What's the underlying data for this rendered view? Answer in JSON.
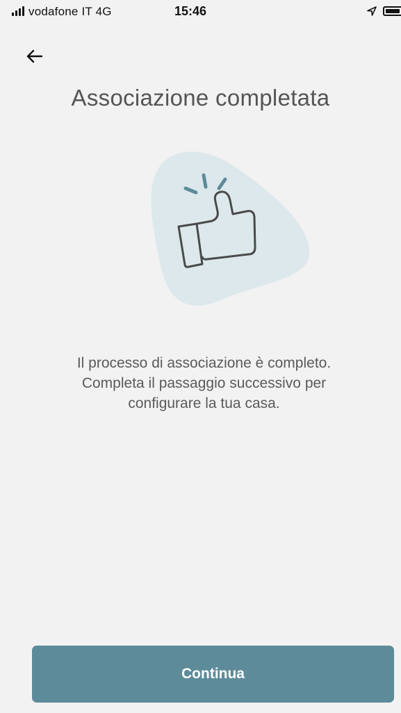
{
  "status_bar": {
    "carrier": "vodafone IT  4G",
    "time": "15:46",
    "icons": [
      "signal-icon",
      "location-icon",
      "battery-icon"
    ]
  },
  "nav": {
    "back_icon": "arrow-left-icon"
  },
  "title": "Associazione completata",
  "illustration": {
    "icon": "thumbs-up-icon"
  },
  "description": [
    "Il processo di associazione è completo.",
    "Completa il passaggio successivo per",
    "configurare la tua casa."
  ],
  "continue_button": {
    "label": "Continua"
  },
  "colors": {
    "background": "#f2f2f2",
    "accent": "#5e8b99",
    "illustration_blob": "#dde8ec",
    "title_text": "#555555"
  }
}
